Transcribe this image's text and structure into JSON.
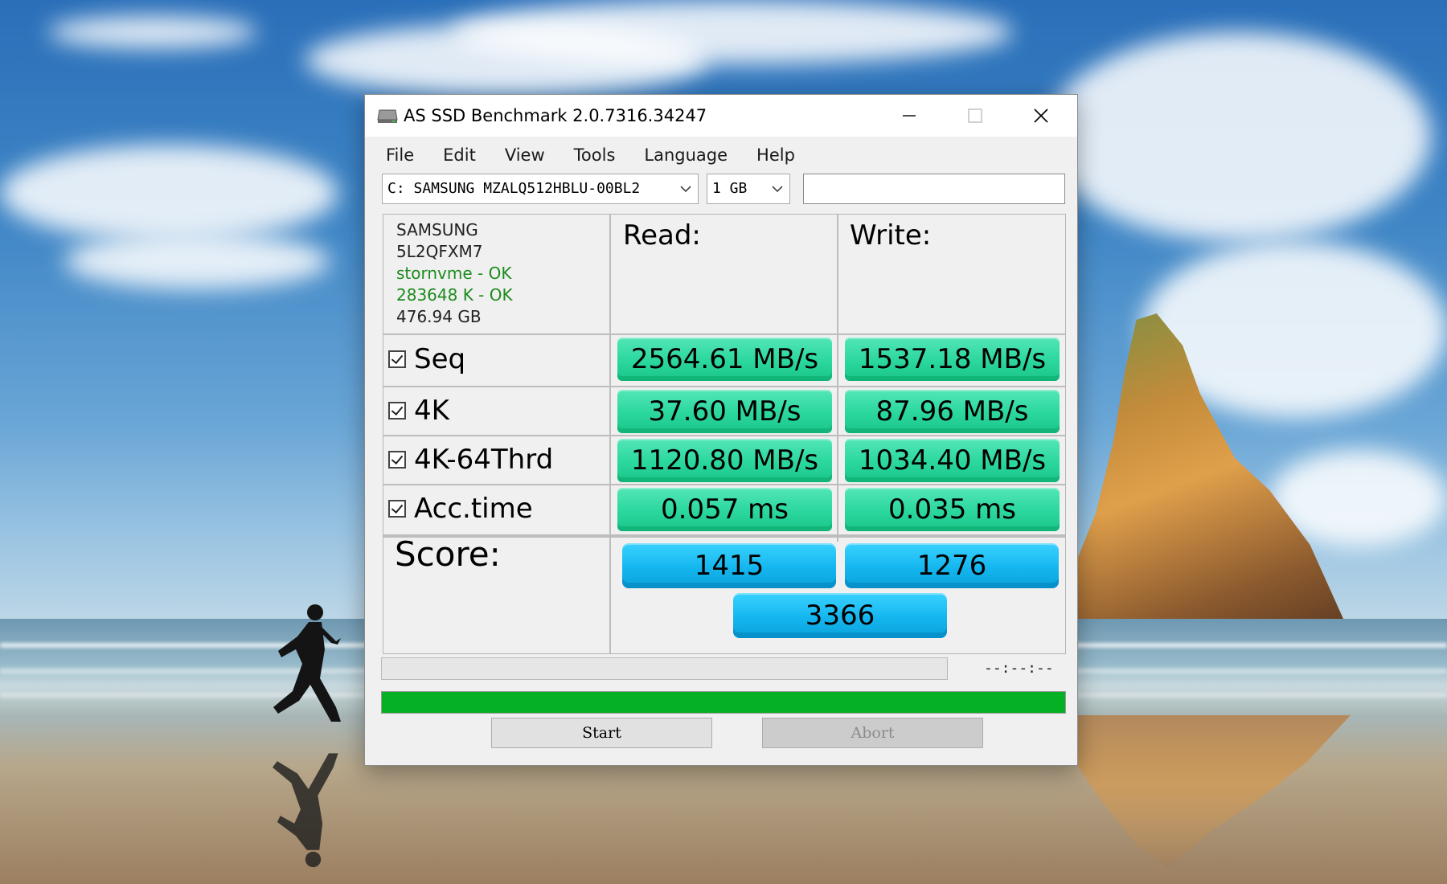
{
  "window": {
    "title": "AS SSD Benchmark 2.0.7316.34247",
    "controls": {
      "minimize": "minimize-icon",
      "maximize": "maximize-icon",
      "close": "close-icon"
    }
  },
  "menu": [
    "File",
    "Edit",
    "View",
    "Tools",
    "Language",
    "Help"
  ],
  "toolbar": {
    "drive": "C: SAMSUNG MZALQ512HBLU-00BL2",
    "size": "1 GB",
    "extra_field_value": ""
  },
  "device": {
    "vendor": "SAMSUNG",
    "firmware": "5L2QFXM7",
    "driver_status": "stornvme - OK",
    "alignment_status": "283648 K - OK",
    "capacity": "476.94 GB"
  },
  "columns": {
    "read": "Read:",
    "write": "Write:"
  },
  "rows": [
    {
      "label": "Seq",
      "checked": true,
      "read": "2564.61 MB/s",
      "write": "1537.18 MB/s"
    },
    {
      "label": "4K",
      "checked": true,
      "read": "37.60 MB/s",
      "write": "87.96 MB/s"
    },
    {
      "label": "4K-64Thrd",
      "checked": true,
      "read": "1120.80 MB/s",
      "write": "1034.40 MB/s"
    },
    {
      "label": "Acc.time",
      "checked": true,
      "read": "0.057 ms",
      "write": "0.035 ms"
    }
  ],
  "score": {
    "label": "Score:",
    "read": "1415",
    "write": "1276",
    "total": "3366"
  },
  "progress": {
    "time": "--:--:--",
    "overall_fraction": 1.0,
    "current_fraction": 0.0
  },
  "buttons": {
    "start": "Start",
    "abort": "Abort"
  },
  "colors": {
    "value_green": "#2ad79d",
    "score_blue": "#14b6ef",
    "progress_green": "#06b025",
    "ok_text": "#1d8a1d"
  }
}
